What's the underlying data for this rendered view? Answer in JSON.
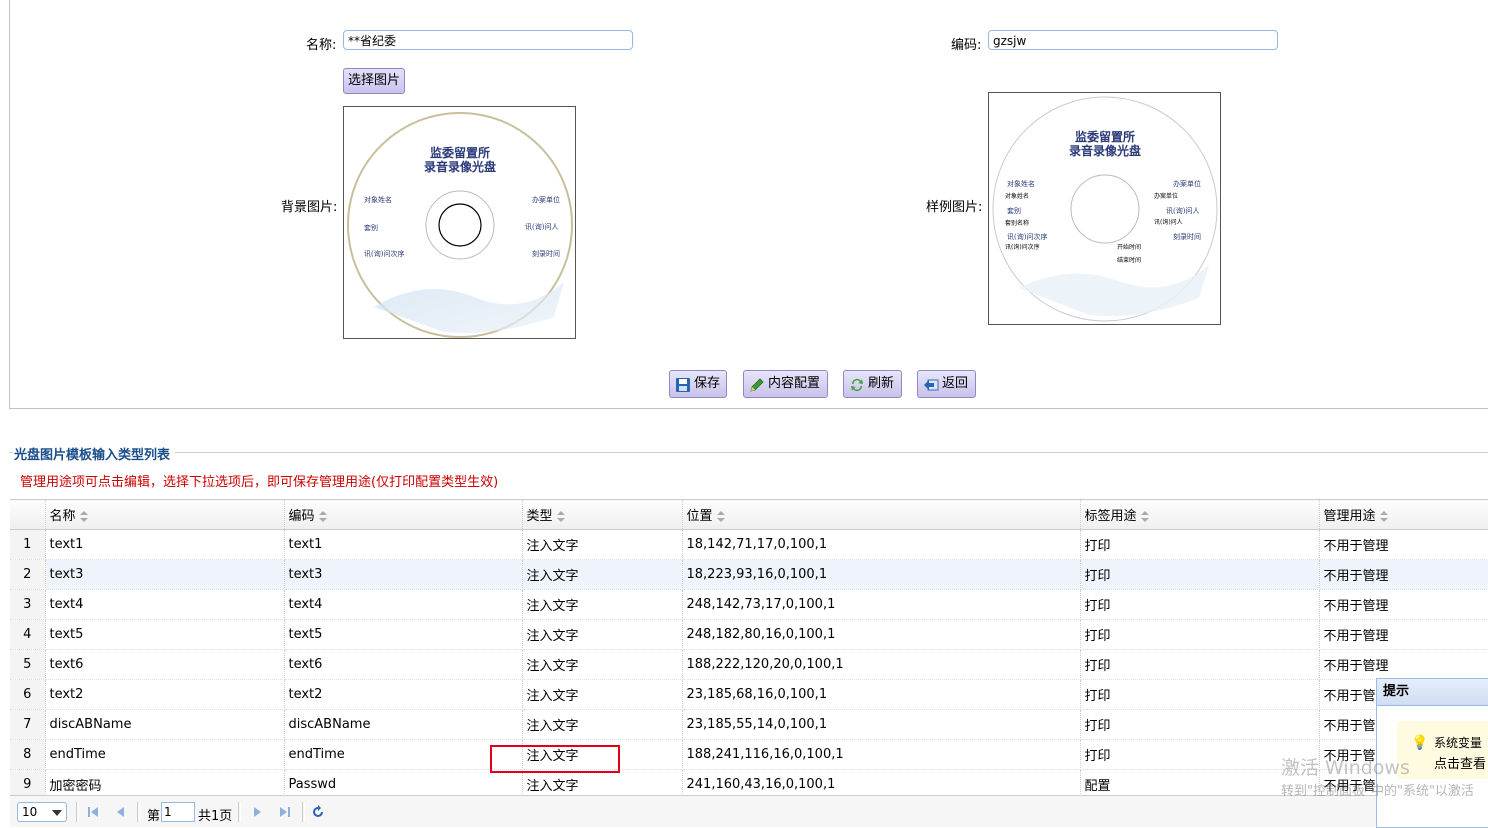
{
  "form": {
    "name_label": "名称:",
    "name_value": "**省纪委",
    "code_label": "编码:",
    "code_value": "gzsjw",
    "pick_image_button": "选择图片",
    "bg_image_label": "背景图片:",
    "sample_image_label": "样例图片:",
    "disc_title_line1": "监委留置所",
    "disc_title_line2": "录音录像光盘",
    "disc_bg_fields": {
      "left": [
        "对象姓名",
        "套别",
        "讯(询)问次序"
      ],
      "right": [
        "办案单位",
        "讯(询)问人",
        "刻录时间"
      ]
    },
    "disc_sample_fields": {
      "left": [
        "对象姓名",
        "对象姓名",
        "套别",
        "套别名称",
        "讯(询)问次序",
        "讯(询)问次序"
      ],
      "right": [
        "办案单位",
        "办案单位",
        "讯(询)问人",
        "讯(询)问人",
        "刻录时间"
      ],
      "center": [
        "开始时间",
        "结束时间"
      ]
    },
    "buttons": {
      "save": "保存",
      "content_config": "内容配置",
      "refresh": "刷新",
      "back": "返回"
    }
  },
  "list": {
    "legend": "光盘图片模板输入类型列表",
    "notice": "管理用途项可点击编辑，选择下拉选项后，即可保存管理用途(仅打印配置类型生效)",
    "columns": [
      "名称",
      "编码",
      "类型",
      "位置",
      "标签用途",
      "管理用途"
    ],
    "rows": [
      {
        "no": "1",
        "name": "text1",
        "code": "text1",
        "type": "注入文字",
        "pos": "18,142,71,17,0,100,1",
        "tag": "打印",
        "mgmt": "不用于管理"
      },
      {
        "no": "2",
        "name": "text3",
        "code": "text3",
        "type": "注入文字",
        "pos": "18,223,93,16,0,100,1",
        "tag": "打印",
        "mgmt": "不用于管理"
      },
      {
        "no": "3",
        "name": "text4",
        "code": "text4",
        "type": "注入文字",
        "pos": "248,142,73,17,0,100,1",
        "tag": "打印",
        "mgmt": "不用于管理"
      },
      {
        "no": "4",
        "name": "text5",
        "code": "text5",
        "type": "注入文字",
        "pos": "248,182,80,16,0,100,1",
        "tag": "打印",
        "mgmt": "不用于管理"
      },
      {
        "no": "5",
        "name": "text6",
        "code": "text6",
        "type": "注入文字",
        "pos": "188,222,120,20,0,100,1",
        "tag": "打印",
        "mgmt": "不用于管理"
      },
      {
        "no": "6",
        "name": "text2",
        "code": "text2",
        "type": "注入文字",
        "pos": "23,185,68,16,0,100,1",
        "tag": "打印",
        "mgmt": "不用于管理"
      },
      {
        "no": "7",
        "name": "discABName",
        "code": "discABName",
        "type": "注入文字",
        "pos": "23,185,55,14,0,100,1",
        "tag": "打印",
        "mgmt": "不用于管理"
      },
      {
        "no": "8",
        "name": "endTime",
        "code": "endTime",
        "type": "注入文字",
        "pos": "188,241,116,16,0,100,1",
        "tag": "打印",
        "mgmt": "不用于管理"
      },
      {
        "no": "9",
        "name": "加密密码",
        "code": "Passwd",
        "type": "注入文字",
        "pos": "241,160,43,16,0,100,1",
        "tag": "配置",
        "mgmt": "不用于管理"
      }
    ]
  },
  "pager": {
    "page_size": "10",
    "page_prefix": "第",
    "page_value": "1",
    "page_total": "共1页"
  },
  "popup": {
    "title": "提示",
    "line1": "系统变量",
    "line2": "点击查看"
  },
  "watermark": {
    "line1": "激活 Windows",
    "line2": "转到\"控制面板\"中的\"系统\"以激活"
  }
}
